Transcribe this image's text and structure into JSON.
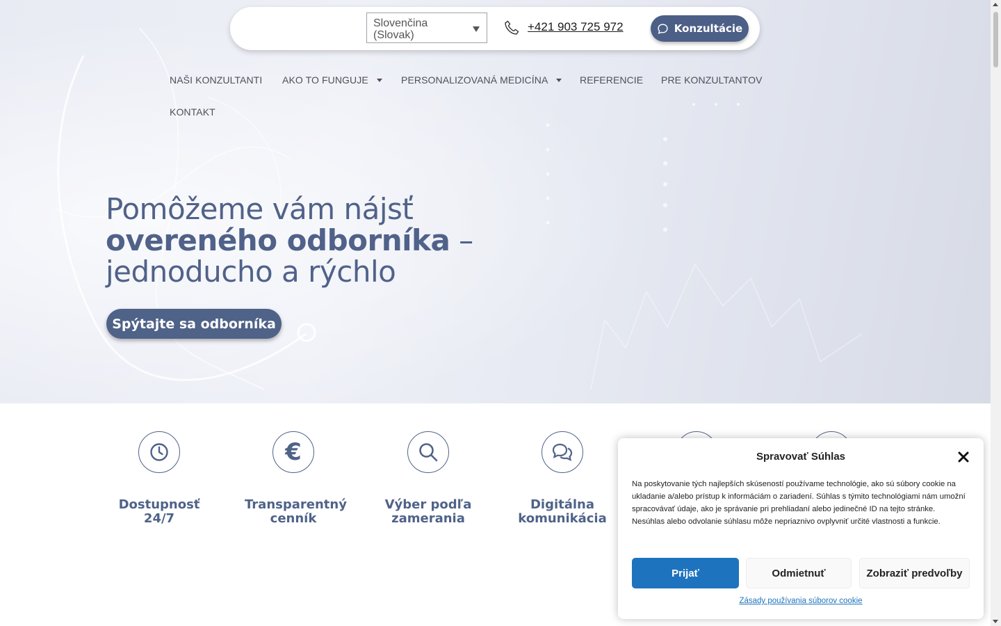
{
  "header": {
    "language": "Slovenčina (Slovak)",
    "phone": "+421 903 725 972",
    "consult_label": "Konzultácie"
  },
  "nav": {
    "items": [
      {
        "label": "NAŠI KONZULTANTI"
      },
      {
        "label": "AKO TO FUNGUJE"
      },
      {
        "label": "PERSONALIZOVANÁ MEDICÍNA"
      },
      {
        "label": "REFERENCIE"
      },
      {
        "label": "PRE KONZULTANTOV"
      },
      {
        "label": "KONTAKT"
      }
    ]
  },
  "hero": {
    "line1": "Pomôžeme vám nájsť",
    "line2_bold": "overeného odborníka",
    "line2_rest": " –",
    "line3": "jednoducho a rýchlo",
    "cta": "Spýtajte sa odborníka"
  },
  "features": [
    {
      "icon": "clock-icon",
      "label": "Dostupnosť 24/7"
    },
    {
      "icon": "euro-icon",
      "label": "Transparentný cenník"
    },
    {
      "icon": "search-icon",
      "label": "Výber podľa zamerania"
    },
    {
      "icon": "chat-icon",
      "label": "Digitálna komunikácia"
    }
  ],
  "cookie": {
    "title": "Spravovať Súhlas",
    "body": "Na poskytovanie tých najlepších skúseností používame technológie, ako sú súbory cookie na ukladanie a/alebo prístup k informáciám o zariadení. Súhlas s týmito technológiami nám umožní spracovávať údaje, ako je správanie pri prehliadaní alebo jedinečné ID na tejto stránke. Nesúhlas alebo odvolanie súhlasu môže nepriaznivo ovplyvniť určité vlastnosti a funkcie.",
    "accept": "Prijať",
    "deny": "Odmietnuť",
    "prefs": "Zobraziť predvoľby",
    "policy": "Zásady používania súborov cookie"
  },
  "colors": {
    "brand": "#4f6288",
    "accept_blue": "#1e73be"
  }
}
